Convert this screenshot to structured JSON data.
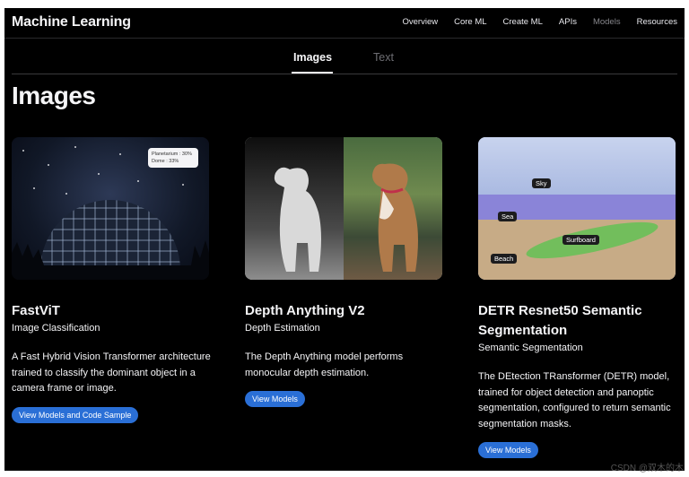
{
  "nav": {
    "brand": "Machine Learning",
    "links": [
      "Overview",
      "Core ML",
      "Create ML",
      "APIs",
      "Models",
      "Resources"
    ]
  },
  "tabs": [
    "Images",
    "Text"
  ],
  "section_title": "Images",
  "cards": [
    {
      "title": "FastViT",
      "subtitle": "Image Classification",
      "description": "A Fast Hybrid Vision Transformer architecture trained to classify the dominant object in a camera frame or image.",
      "button": "View Models and Code Sample",
      "tooltip": [
        "Planetarium : 30%",
        "Dome : 33%"
      ]
    },
    {
      "title": "Depth Anything V2",
      "subtitle": "Depth Estimation",
      "description": "The Depth Anything model performs monocular depth estimation.",
      "button": "View Models"
    },
    {
      "title": "DETR Resnet50 Semantic Segmentation",
      "subtitle": "Semantic Segmentation",
      "description": "The DEtection TRansformer (DETR) model, trained for object detection and panoptic segmentation, configured to return semantic segmentation masks.",
      "button": "View Models",
      "labels": [
        "Sky",
        "Sea",
        "Surfboard",
        "Beach"
      ]
    }
  ],
  "watermark": "CSDN @双木的木",
  "colors": {
    "background": "#000000",
    "button": "#2a6fd6",
    "text": "#f5f5f7"
  }
}
